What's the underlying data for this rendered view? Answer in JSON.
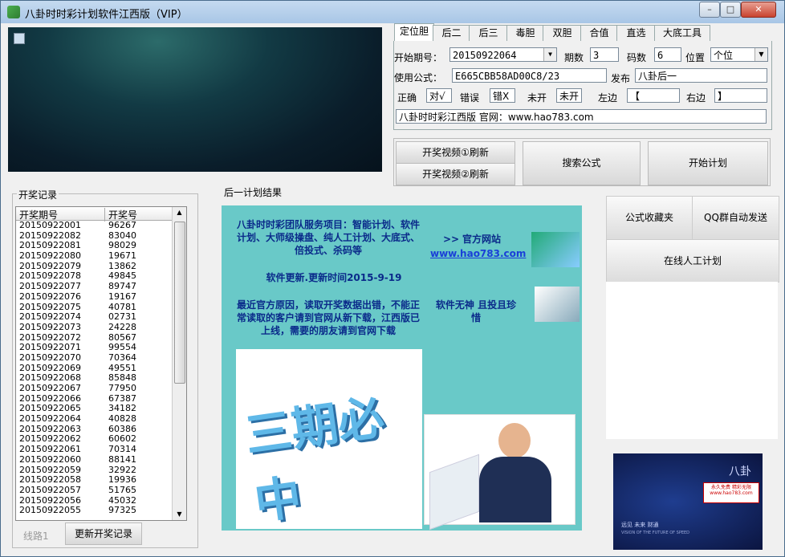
{
  "window": {
    "title": "八卦时时彩计划软件江西版（VIP）",
    "min": "–",
    "max": "□",
    "close": "✕"
  },
  "tabs": [
    "定位胆",
    "后二",
    "后三",
    "毒胆",
    "双胆",
    "合值",
    "直选",
    "大底工具"
  ],
  "form": {
    "start_label": "开始期号：",
    "start_value": "20150922064",
    "periods_label": "期数",
    "periods_value": "3",
    "codes_label": "码数",
    "codes_value": "6",
    "position_label": "位置",
    "position_value": "个位",
    "formula_label": "使用公式：",
    "formula_value": "E665CBB58AD00C8/23",
    "publish_label": "发布",
    "publish_value": "八卦后一",
    "correct_label": "正确",
    "correct_value": "对√",
    "wrong_label": "错误",
    "wrong_value": "错X",
    "unopen_label": "未开",
    "unopen_value": "未开",
    "left_label": "左边",
    "left_value": "【",
    "right_label": "右边",
    "right_value": "】",
    "info_value": "八卦时时彩江西版 官网：www.hao783.com"
  },
  "buttons": {
    "video1": "开奖视频①刷新",
    "video2": "开奖视频②刷新",
    "search": "搜索公式",
    "start_plan": "开始计划",
    "refresh": "更新开奖记录",
    "line": "线路1",
    "favorites": "公式收藏夹",
    "qq_send": "QQ群自动发送",
    "manual": "在线人工计划"
  },
  "lottery": {
    "legend": "开奖记录",
    "col_period": "开奖期号",
    "col_number": "开奖号",
    "rows": [
      [
        "20150922001",
        "96267"
      ],
      [
        "20150922082",
        "83040"
      ],
      [
        "20150922081",
        "98029"
      ],
      [
        "20150922080",
        "19671"
      ],
      [
        "20150922079",
        "13862"
      ],
      [
        "20150922078",
        "49845"
      ],
      [
        "20150922077",
        "89747"
      ],
      [
        "20150922076",
        "19167"
      ],
      [
        "20150922075",
        "40781"
      ],
      [
        "20150922074",
        "02731"
      ],
      [
        "20150922073",
        "24228"
      ],
      [
        "20150922072",
        "80567"
      ],
      [
        "20150922071",
        "99554"
      ],
      [
        "20150922070",
        "70364"
      ],
      [
        "20150922069",
        "49551"
      ],
      [
        "20150922068",
        "85848"
      ],
      [
        "20150922067",
        "77950"
      ],
      [
        "20150922066",
        "67387"
      ],
      [
        "20150922065",
        "34182"
      ],
      [
        "20150922064",
        "40828"
      ],
      [
        "20150922063",
        "60386"
      ],
      [
        "20150922062",
        "60602"
      ],
      [
        "20150922061",
        "70314"
      ],
      [
        "20150922060",
        "88141"
      ],
      [
        "20150922059",
        "32922"
      ],
      [
        "20150922058",
        "19936"
      ],
      [
        "20150922057",
        "51765"
      ],
      [
        "20150922056",
        "45032"
      ],
      [
        "20150922055",
        "97325"
      ]
    ]
  },
  "result": {
    "title": "后一计划结果",
    "ad_service": "八卦时时彩团队服务项目：智能计划、软件计划、大师级操盘、纯人工计划、大底式、倍投式、杀码等",
    "ad_site_label": "官方网站",
    "ad_site_arrow": ">>",
    "ad_site_url": "www.hao783.com",
    "ad_update": "软件更新.更新时间2015-9-19",
    "ad_notice": "最近官方原因，读取开奖数据出错，不能正常读取的客户请到官网从新下载，江西版已上线，需要的朋友请到官网下载",
    "ad_warning": "软件无神 且投且珍惜",
    "ad_slogan": "三期必中"
  },
  "ad2": {
    "brand": "八卦",
    "red": "永久免费 精彩无限",
    "url": "www.hao783.com",
    "line1": "远见 未来 财通",
    "line2": "VISION OF THE FUTURE OF SPEED"
  }
}
